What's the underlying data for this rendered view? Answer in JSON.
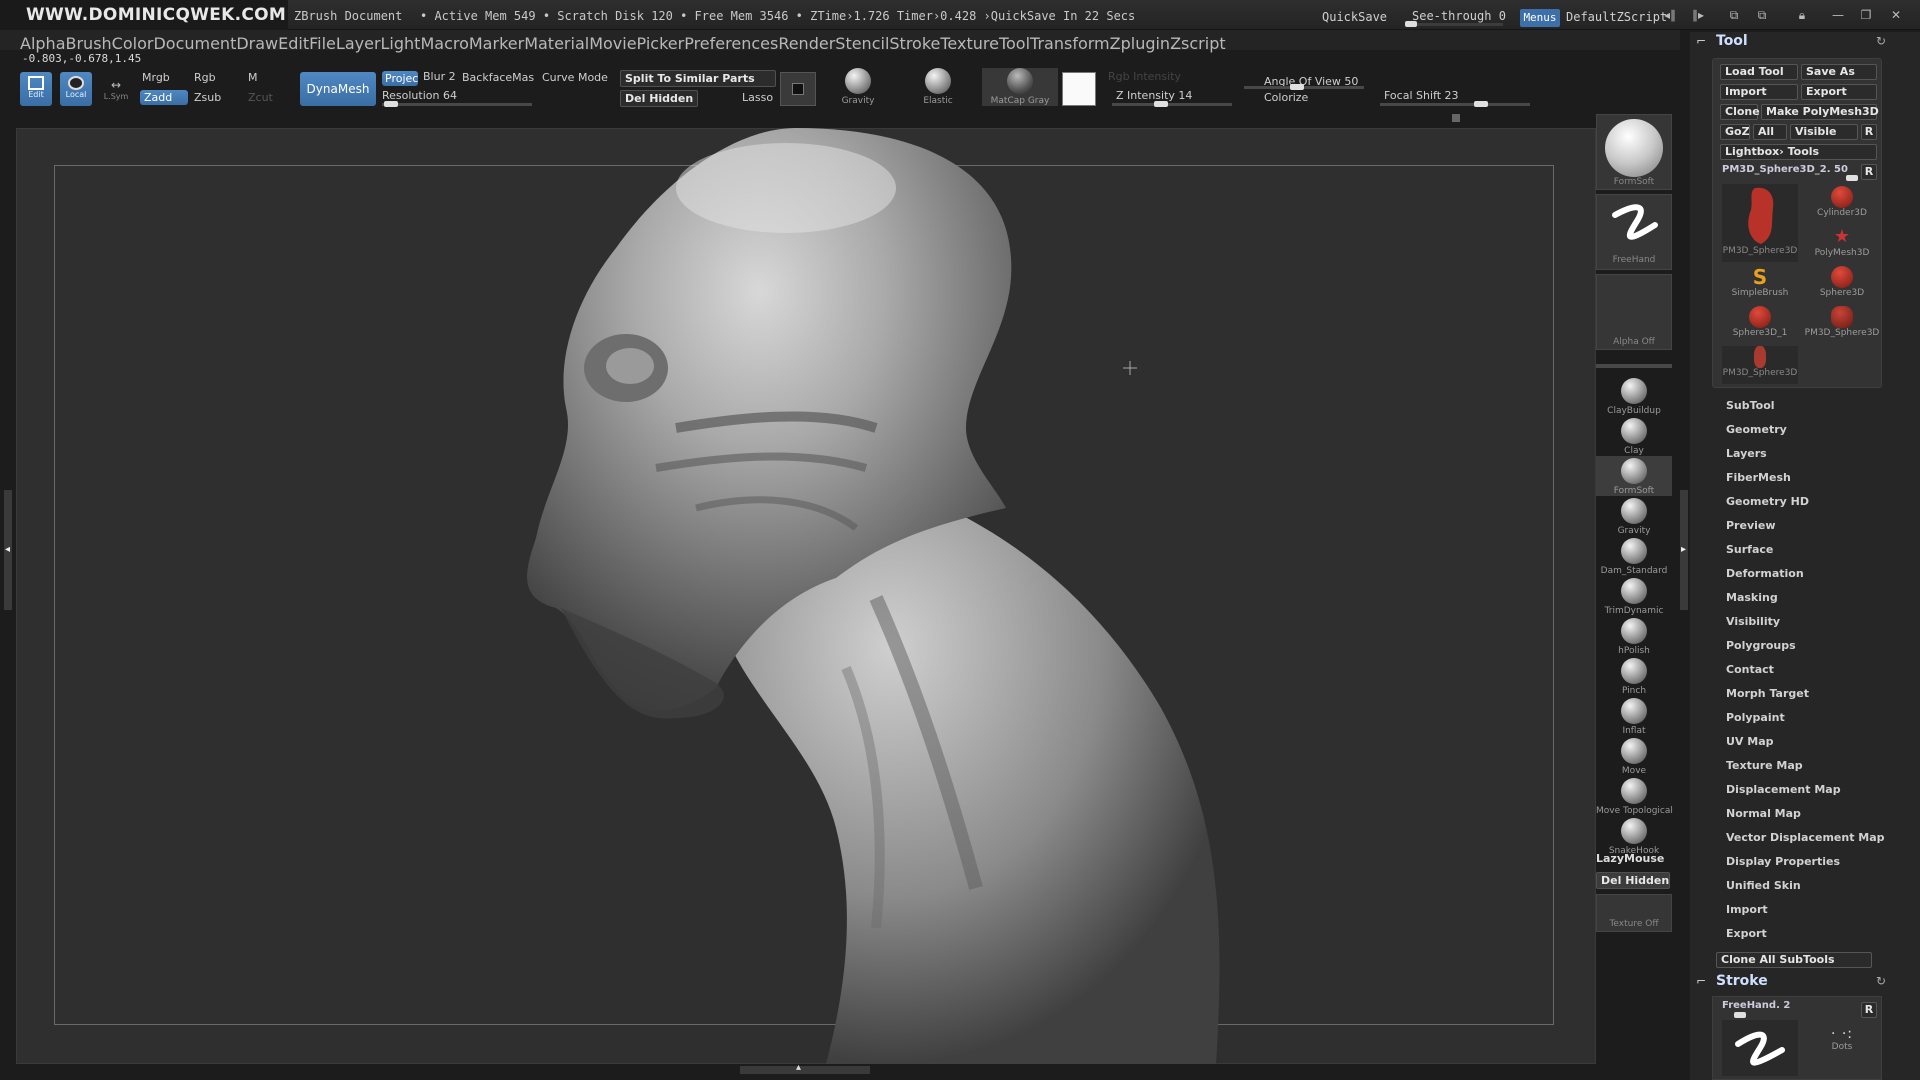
{
  "brand": "WWW.DOMINICQWEK.COM",
  "titlebar": {
    "document": "ZBrush Document",
    "stats": "• Active Mem 549 • Scratch Disk 120 • Free Mem 3546 • ZTime›1.726 Timer›0.428 ›QuickSave In 22 Secs",
    "quicksave": "QuickSave",
    "seethrough": "See-through  0",
    "menus": "Menus",
    "defaultzscript": "DefaultZScript"
  },
  "menubar": [
    "Alpha",
    "Brush",
    "Color",
    "Document",
    "Draw",
    "Edit",
    "File",
    "Layer",
    "Light",
    "Macro",
    "Marker",
    "Material",
    "Movie",
    "Picker",
    "Preferences",
    "Render",
    "Stencil",
    "Stroke",
    "Texture",
    "Tool",
    "Transform",
    "Zplugin",
    "Zscript"
  ],
  "coords": "-0.803,-0.678,1.45",
  "shelf": {
    "edit": "Edit",
    "local": "Local",
    "lsym": "L.Sym",
    "mrgb": "Mrgb",
    "rgb": "Rgb",
    "m": "M",
    "zadd": "Zadd",
    "zsub": "Zsub",
    "zcut": "Zcut",
    "dynamesh": "DynaMesh",
    "project": "Projec",
    "blur": "Blur 2",
    "backface": "BackfaceMas",
    "curve_mode": "Curve Mode",
    "resolution": "Resolution 64",
    "split": "Split To Similar Parts",
    "del_hidden": "Del Hidden",
    "lasso": "Lasso",
    "gravity": "Gravity",
    "elastic": "Elastic",
    "matcap": "MatCap Gray",
    "rgb_intensity": "Rgb Intensity",
    "z_intensity": "Z Intensity 14",
    "angle_of_view": "Angle Of View 50",
    "colorize": "Colorize",
    "focal_shift": "Focal Shift 23"
  },
  "brush_shelf": {
    "current_brush": "FormSoft",
    "stroke": "FreeHand",
    "alpha": "Alpha Off",
    "brushes": [
      "ClayBuildup",
      "Clay",
      "FormSoft",
      "Gravity",
      "Dam_Standard",
      "TrimDynamic",
      "hPolish",
      "Pinch",
      "Inflat",
      "Move",
      "Move Topological",
      "SnakeHook"
    ],
    "lazymouse": "LazyMouse",
    "del_hidden": "Del Hidden",
    "texture": "Texture Off"
  },
  "tool_palette": {
    "title": "Tool",
    "load_tool": "Load Tool",
    "save_as": "Save As",
    "import": "Import",
    "export": "Export",
    "clone": "Clone",
    "make_polymesh": "Make PolyMesh3D",
    "goz": "GoZ",
    "all": "All",
    "visible": "Visible",
    "r": "R",
    "lightbox_tools": "Lightbox› Tools",
    "current_tool": "PM3D_Sphere3D_2. 50",
    "thumbs": [
      "PM3D_Sphere3D",
      "Cylinder3D",
      "PolyMesh3D",
      "SimpleBrush",
      "Sphere3D",
      "Sphere3D_1",
      "PM3D_Sphere3D",
      "PM3D_Sphere3D"
    ],
    "sections": [
      "SubTool",
      "Geometry",
      "Layers",
      "FiberMesh",
      "Geometry HD",
      "Preview",
      "Surface",
      "Deformation",
      "Masking",
      "Visibility",
      "Polygroups",
      "Contact",
      "Morph Target",
      "Polypaint",
      "UV Map",
      "Texture Map",
      "Displacement Map",
      "Normal Map",
      "Vector Displacement Map",
      "Display Properties",
      "Unified Skin",
      "Import",
      "Export"
    ],
    "clone_all": "Clone All SubTools"
  },
  "stroke_palette": {
    "title": "Stroke",
    "freehand": "FreeHand. 2",
    "dots": "Dots"
  },
  "colors": {
    "accent": "#3d6fa8",
    "canvas": "#2f2f2f",
    "model_highlight": "#d9d9d9",
    "tool_red": "#b8322a"
  }
}
